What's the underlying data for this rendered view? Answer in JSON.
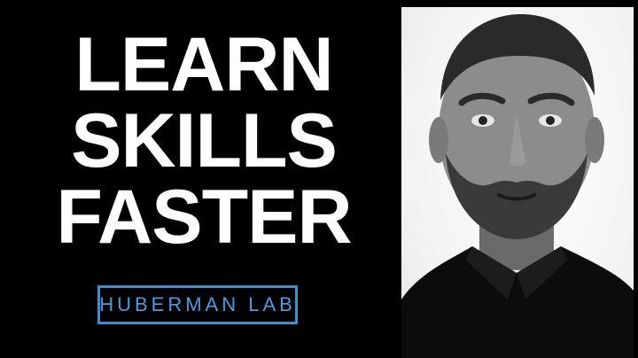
{
  "headline": {
    "line1": "LEARN",
    "line2": "SKILLS",
    "line3": "FASTER"
  },
  "logo": {
    "text": "HUBERMAN LAB"
  },
  "colors": {
    "background": "#000000",
    "headline_text": "#ffffff",
    "logo_accent": "#3f8fd0",
    "photo_background": "#f4f4f4"
  },
  "portrait": {
    "style": "black-and-white"
  }
}
